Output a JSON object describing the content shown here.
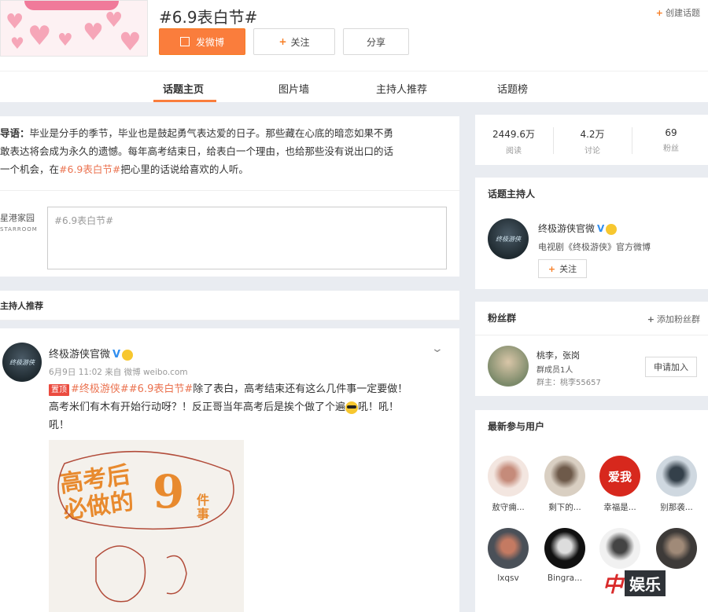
{
  "topic": {
    "title": "#6.9表白节#",
    "create_topic": "创建话题"
  },
  "actions": {
    "post": "发微博",
    "follow": "关注",
    "share": "分享"
  },
  "tabs": [
    {
      "label": "话题主页",
      "active": true
    },
    {
      "label": "图片墙",
      "active": false
    },
    {
      "label": "主持人推荐",
      "active": false
    },
    {
      "label": "话题榜",
      "active": false
    }
  ],
  "intro": {
    "lead": "导语：",
    "line1": "毕业是分手的季节，毕业也是鼓起勇气表达爱的日子。那些藏在心底的暗恋如果不勇",
    "line2": "敢表达将会成为永久的遗憾。每年高考结束日，给表白一个理由，也给那些没有说出口的话",
    "line3_pre": "一个机会，在",
    "line3_tag": "#6.9表白节#",
    "line3_post": "把心里的话说给喜欢的人听。"
  },
  "composer": {
    "studio_line1": "星港家园",
    "studio_line2": "STARROOM",
    "placeholder": "#6.9表白节#"
  },
  "host_recommend_label": "主持人推荐",
  "post": {
    "author": "终极游侠官微",
    "meta": "6月9日 11:02 来自 微博 weibo.com",
    "pin": "置顶",
    "tags": "#终极游侠##6.9表白节#",
    "text1": "除了表白，高考结束还有这么几件事一定要做！",
    "text2a": "高考米们有木有开始行动呀？！反正哥当年高考后是挨个做了个遍",
    "text2b": "吼！吼！",
    "text3": "吼！",
    "image": {
      "line1": "高考后",
      "line2": "必做的",
      "nine": "9",
      "sub": "件事"
    }
  },
  "stats": [
    {
      "num": "2449.6万",
      "label": "阅读"
    },
    {
      "num": "4.2万",
      "label": "讨论"
    },
    {
      "num": "69",
      "label": "粉丝"
    }
  ],
  "host": {
    "title": "话题主持人",
    "avatar_text": "终极游侠",
    "name": "终极游侠官微",
    "desc": "电视剧《终极游侠》官方微博",
    "follow": "关注"
  },
  "fans_group": {
    "title": "粉丝群",
    "add": "添加粉丝群",
    "name": "桃李，张岗",
    "count": "群成员1人",
    "owner": "群主：桃李55657",
    "apply": "申请加入"
  },
  "users": {
    "title": "最新参与用户",
    "list": [
      {
        "name": "敖守痈...",
        "color": "#f3e6e0",
        "accent": "#c58b7a"
      },
      {
        "name": "剩下的...",
        "color": "#d9cfc2",
        "accent": "#6e5a4a"
      },
      {
        "name": "幸福是...",
        "color": "#d7281d",
        "accent": "#ffffff",
        "text": "爱我"
      },
      {
        "name": "别那袭...",
        "color": "#cfd8e0",
        "accent": "#34404a"
      },
      {
        "name": "lxqsv",
        "color": "#4a5058",
        "accent": "#c47a62"
      },
      {
        "name": "Bingra...",
        "color": "#111111",
        "accent": "#dddddd"
      },
      {
        "name": "",
        "color": "#f1f1f1",
        "accent": "#444444"
      },
      {
        "name": "",
        "color": "#3d3a38",
        "accent": "#a08a78"
      }
    ]
  },
  "watermark": {
    "zhong": "中",
    "yule": "娱乐"
  }
}
